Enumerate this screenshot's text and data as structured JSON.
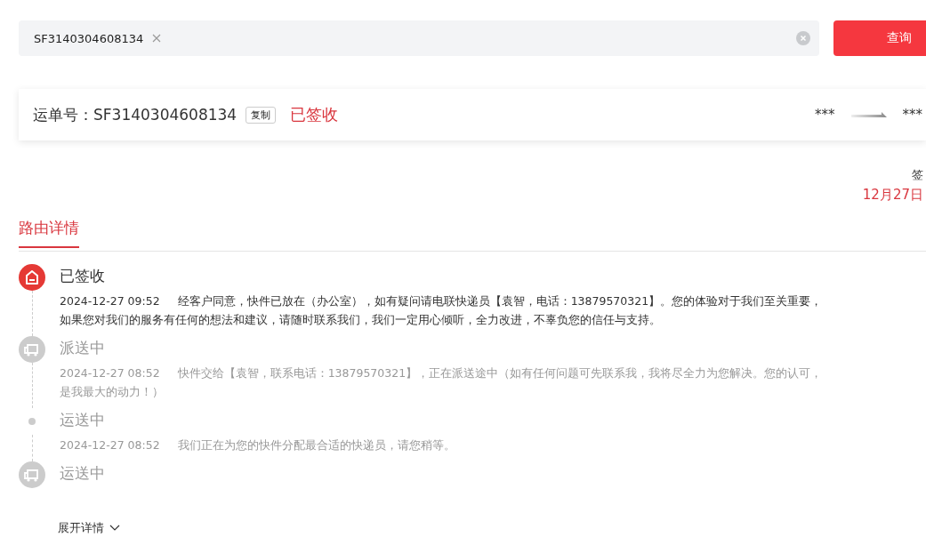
{
  "search": {
    "value": "SF3140304608134",
    "button": "查询"
  },
  "waybill": {
    "label": "运单号：",
    "number": "SF3140304608134",
    "copy": "复制",
    "status": "已签收",
    "from": "***",
    "to": "***"
  },
  "summary": {
    "label": "签",
    "date": "12月27日"
  },
  "tabs": [
    {
      "label": "路由详情",
      "selected": true
    }
  ],
  "events": [
    {
      "kind": "house",
      "current": true,
      "title": "已签收",
      "time": "2024-12-27 09:52",
      "text": "经客户同意，快件已放在（办公室），如有疑问请电联快递员【袁智，电话：13879570321】。您的体验对于我们至关重要，如果您对我们的服务有任何的想法和建议，请随时联系我们，我们一定用心倾听，全力改进，不辜负您的信任与支持。"
    },
    {
      "kind": "truck",
      "current": false,
      "title": "派送中",
      "time": "2024-12-27 08:52",
      "text": "快件交给【袁智，联系电话：13879570321】，正在派送途中（如有任何问题可先联系我，我将尽全力为您解决。您的认可，是我最大的动力！）"
    },
    {
      "kind": "dot",
      "current": false,
      "title": "运送中",
      "time": "2024-12-27 08:52",
      "text": "我们正在为您的快件分配最合适的快递员，请您稍等。"
    },
    {
      "kind": "truck",
      "current": false,
      "title": "运送中"
    }
  ],
  "expand": "展开详情"
}
